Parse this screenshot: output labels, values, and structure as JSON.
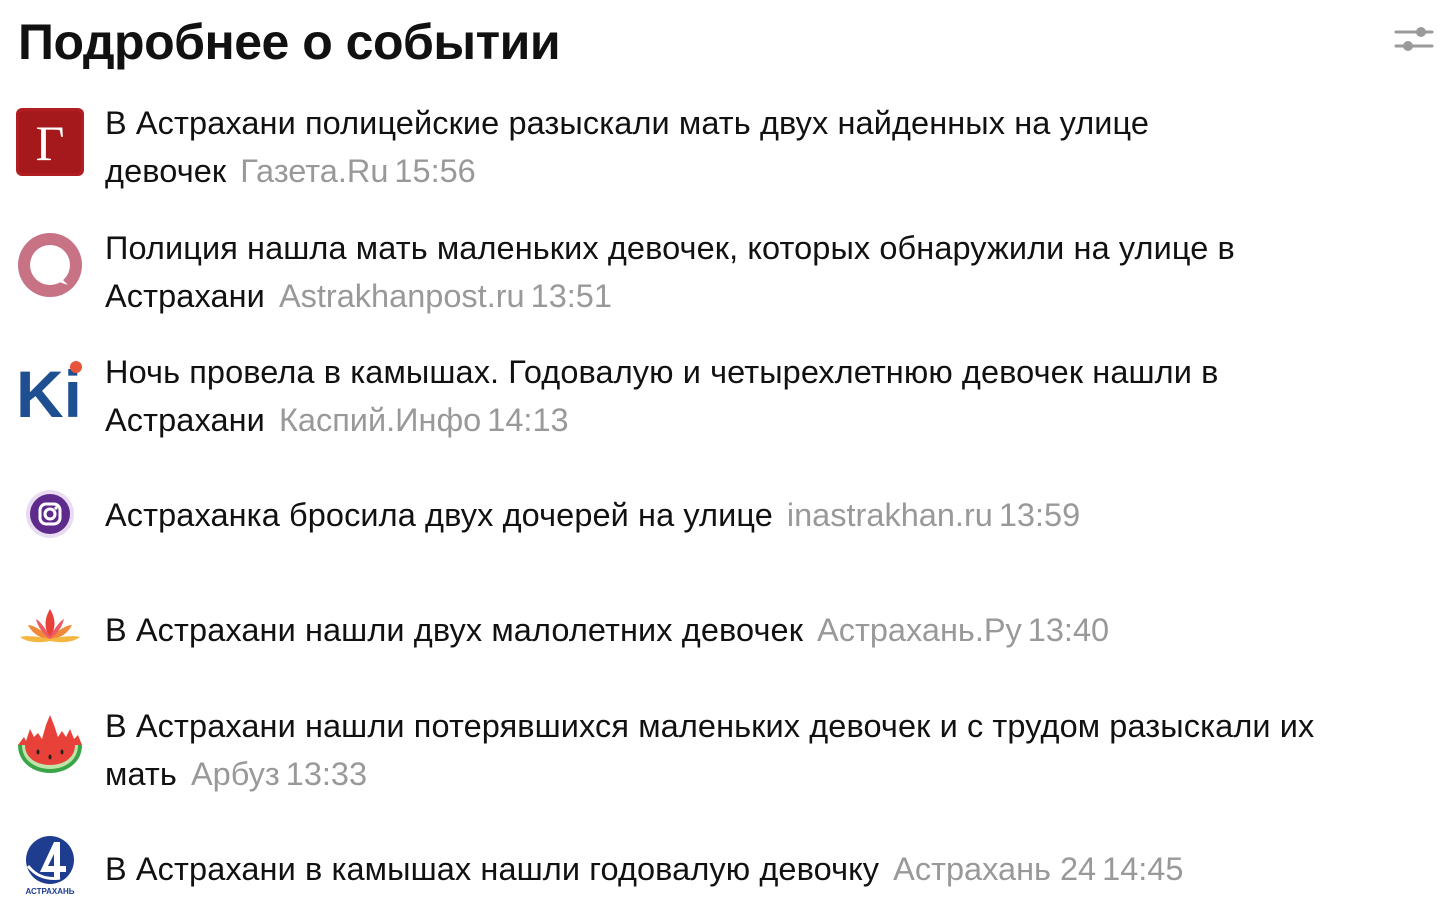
{
  "header": {
    "title": "Подробнее о событии",
    "settings_icon": "sliders-icon"
  },
  "news": [
    {
      "headline": "В Астрахани полицейские разыскали мать двух найденных на улице девочек",
      "source": "Газета.Ru",
      "time": "15:56",
      "logo_icon": "gazeta-ru-logo-icon",
      "logo_letter": "Г",
      "logo_color": "#b11e22"
    },
    {
      "headline": "Полиция нашла мать маленьких девочек, которых обнаружили на улице в Астрахани",
      "source": "Astrakhanpost.ru",
      "time": "13:51",
      "logo_icon": "astrakhanpost-logo-icon",
      "logo_color": "#c06a7c"
    },
    {
      "headline": "Ночь провела в камышах. Годовалую и четырехлетнюю девочек нашли в Астрахани",
      "source": "Каспий.Инфо",
      "time": "14:13",
      "logo_icon": "kaspiy-info-logo-icon",
      "logo_letter": "Ki",
      "logo_color": "#1d4f91"
    },
    {
      "headline": "Астраханка бросила двух дочерей на улице",
      "source": "inastrakhan.ru",
      "time": "13:59",
      "logo_icon": "inastrakhan-logo-icon",
      "logo_color": "#5e2b8c"
    },
    {
      "headline": "В Астрахани нашли двух малолетних девочек",
      "source": "Астрахань.Ру",
      "time": "13:40",
      "logo_icon": "lotus-logo-icon",
      "logo_color": "#e84a3a"
    },
    {
      "headline": "В Астрахани нашли потерявшихся маленьких девочек и с трудом разыскали их мать",
      "source": "Арбуз",
      "time": "13:33",
      "logo_icon": "watermelon-logo-icon",
      "logo_color": "#e8413a"
    },
    {
      "headline": "В Астрахани в камышах нашли годовалую девочку",
      "source": "Астрахань 24",
      "time": "14:45",
      "logo_icon": "astrakhan24-logo-icon",
      "logo_caption": "АСТРАХАНЬ",
      "logo_color": "#1e3d8f"
    }
  ]
}
